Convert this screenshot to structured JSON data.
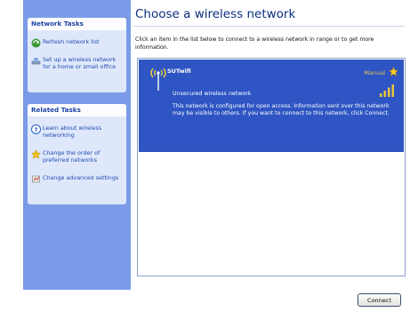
{
  "network_tasks": {
    "header": "Network Tasks",
    "items": [
      {
        "label": "Refresh network list",
        "icon": "refresh-icon"
      },
      {
        "label": "Set up a wireless network for a home or small office",
        "icon": "wireless-setup-icon"
      }
    ]
  },
  "related_tasks": {
    "header": "Related Tasks",
    "items": [
      {
        "label": "Learn about wireless networking",
        "icon": "help-icon"
      },
      {
        "label": "Change the order of preferred networks",
        "icon": "star-icon"
      },
      {
        "label": "Change advanced settings",
        "icon": "settings-icon"
      }
    ]
  },
  "main": {
    "title": "Choose a wireless network",
    "instruction": "Click an item in the list below to connect to a wireless network in range or to get more information."
  },
  "networks": [
    {
      "ssid": "SUTwifi",
      "connection_type": "Manual",
      "security": "Unsecured wireless network",
      "signal_bars": 4,
      "description": "This network is configured for open access. Information sent over this network may be visible to others. If you want to connect to this network, click Connect.",
      "selected": true
    }
  ],
  "connect_button": "Connect",
  "colors": {
    "task_pane": "#7a9be8",
    "selected_item": "#2e55c3",
    "title": "#0b2e7e",
    "manual_text": "#e8c34a"
  }
}
